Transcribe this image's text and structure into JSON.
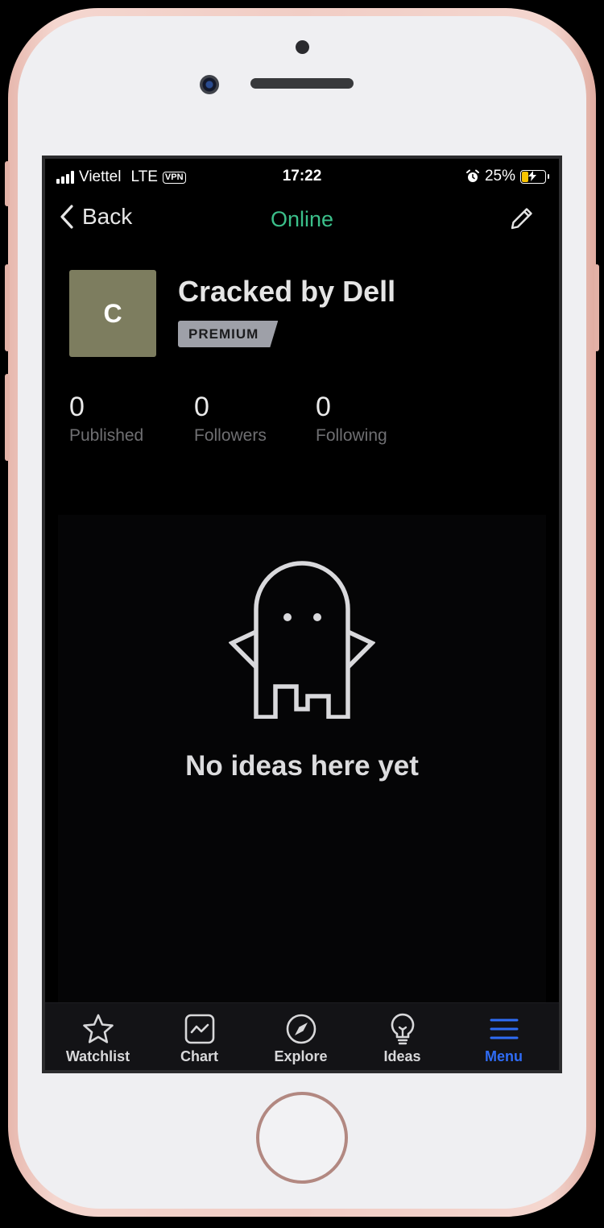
{
  "status_bar": {
    "carrier": "Viettel",
    "network": "LTE",
    "vpn": "VPN",
    "time": "17:22",
    "battery_percent": "25%",
    "battery_level": 0.25,
    "battery_color": "#f7c300"
  },
  "nav": {
    "back_label": "Back",
    "title": "Online",
    "title_color": "#3bbf8a",
    "edit_icon": "pencil-icon"
  },
  "profile": {
    "avatar_initial": "C",
    "avatar_color": "#7d7d5f",
    "name": "Cracked by Dell",
    "badge": "PREMIUM"
  },
  "stats": [
    {
      "value": "0",
      "label": "Published"
    },
    {
      "value": "0",
      "label": "Followers"
    },
    {
      "value": "0",
      "label": "Following"
    }
  ],
  "empty_state": {
    "icon": "ghost-icon",
    "message": "No ideas here yet"
  },
  "tabbar": {
    "active_color": "#2f6cf5",
    "items": [
      {
        "label": "Watchlist",
        "icon": "star-icon"
      },
      {
        "label": "Chart",
        "icon": "chart-icon"
      },
      {
        "label": "Explore",
        "icon": "compass-icon"
      },
      {
        "label": "Ideas",
        "icon": "lightbulb-icon"
      },
      {
        "label": "Menu",
        "icon": "menu-icon",
        "active": true
      }
    ]
  }
}
